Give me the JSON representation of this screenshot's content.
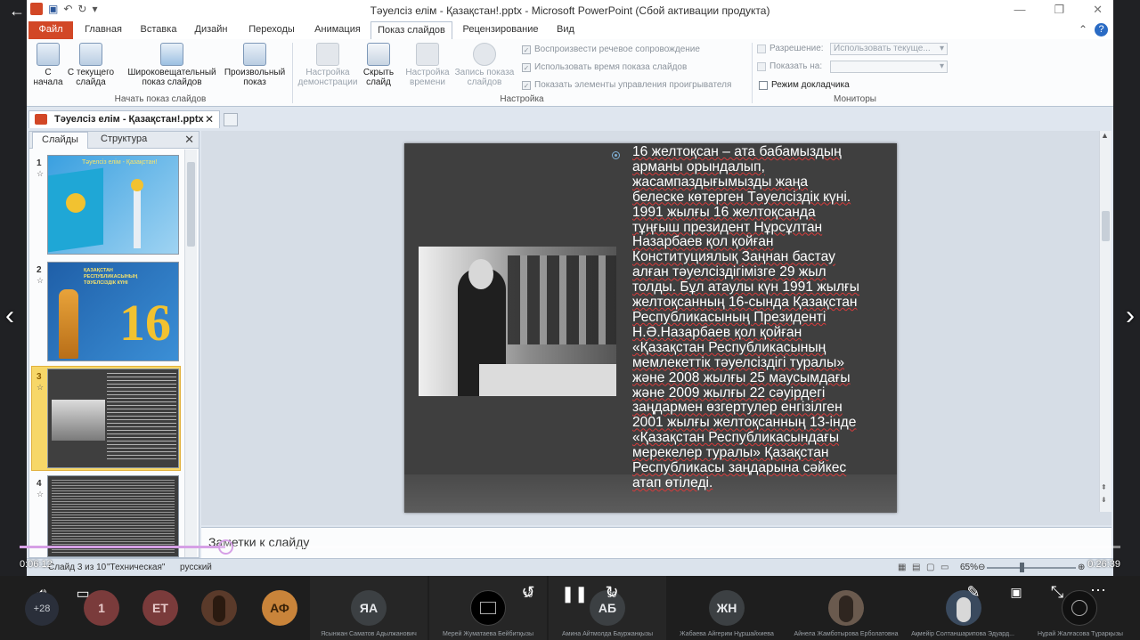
{
  "window": {
    "title": "Тәуелсіз елім - Қазақстан!.pptx  -  Microsoft PowerPoint (Сбой активации продукта)"
  },
  "ribbon_tabs": [
    {
      "label": "Файл"
    },
    {
      "label": "Главная"
    },
    {
      "label": "Вставка"
    },
    {
      "label": "Дизайн"
    },
    {
      "label": "Переходы"
    },
    {
      "label": "Анимация"
    },
    {
      "label": "Показ слайдов"
    },
    {
      "label": "Рецензирование"
    },
    {
      "label": "Вид"
    }
  ],
  "ribbon": {
    "start_group": {
      "label": "Начать показ слайдов",
      "buttons": [
        {
          "label": "С начала"
        },
        {
          "label": "С текущего слайда"
        },
        {
          "label": "Широковещательный показ слайдов"
        },
        {
          "label": "Произвольный показ"
        }
      ]
    },
    "setup_group": {
      "label": "Настройка",
      "buttons": [
        {
          "label": "Настройка демонстрации"
        },
        {
          "label": "Скрыть слайд"
        },
        {
          "label": "Настройка времени"
        },
        {
          "label": "Запись показа слайдов"
        }
      ],
      "checks": [
        {
          "label": "Воспроизвести речевое сопровождение"
        },
        {
          "label": "Использовать время показа слайдов"
        },
        {
          "label": "Показать элементы управления проигрывателя"
        }
      ]
    },
    "monitors_group": {
      "label": "Мониторы",
      "resolution_label": "Разрешение:",
      "resolution_value": "Использовать текуще...",
      "show_on_label": "Показать на:",
      "presenter_label": "Режим докладчика"
    }
  },
  "document_tab": {
    "label": "Тәуелсіз елім - Қазақстан!.pptx"
  },
  "slides_pane": {
    "tabs": [
      {
        "label": "Слайды"
      },
      {
        "label": "Структура"
      }
    ],
    "slides": [
      {
        "number": "1",
        "title": "Тәуелсіз елім - Қазақстан!"
      },
      {
        "number": "2",
        "title": "ҚАЗАҚСТАН РЕСПУБЛИКАСЫНЫҢ ТӘУЕЛСІЗДІК КҮНІ",
        "big": "16"
      },
      {
        "number": "3"
      },
      {
        "number": "4"
      }
    ]
  },
  "slide": {
    "lines": [
      "16 желтоқсан – ата бабамыздың",
      "арманы орындалып,",
      "жасампаздығымызды жаңа",
      "белеске көтерген Тәуелсіздік күні.",
      "1991 жылғы 16 желтоқсанда",
      "тұңғыш  президент  Нұрсұлтан",
      "Назарбаев  қол  қойған",
      "Конституциялық  Заңнан  бастау",
      "алған тәуелсіздігімізге  29  жыл",
      "толды. Бұл атаулы күн 1991 жылғы",
      "желтоқсанның  16-сында  Қазақстан",
      "Республикасының  Президенті",
      "Н.Ә.Назарбаев  қол  қойған",
      "«Қазақстан Республикасының",
      "мемлекеттік тәуелсіздігі туралы»",
      "және 2008 жылғы 25 маусымдағы",
      "және 2009 жылғы 22 сәуірдегі",
      "заңдармен өзгертулер енгізілген",
      "2001 жылғы желтоқсанның  13-інде",
      "«Қазақстан Республикасындағы",
      "мерекелер туралы» Қазақстан",
      "Республикасы  заңдарына  сәйкес",
      "атап өтіледі."
    ]
  },
  "notes": {
    "placeholder": "Заметки к слайду"
  },
  "status": {
    "slide_info": "Слайд 3 из 10",
    "theme": "\"Техническая\"",
    "language": "русский",
    "zoom": "65%"
  },
  "video": {
    "current_time": "0:06:12",
    "duration": "0:26:39",
    "progress": 0.187,
    "skip_back": "10",
    "skip_forward": "30",
    "participant_count": "+28"
  },
  "participants": [
    {
      "initials": "1",
      "color": "#7a3b3b"
    },
    {
      "initials": "ЕТ",
      "color": "#7a3b3b"
    },
    {
      "initials": "",
      "color": "#5a3a2a"
    },
    {
      "initials": "АФ",
      "color": "#c9843a"
    },
    {
      "initials": "ЯА",
      "name": "Ясынжан Саматов Адылжанович",
      "color": "#3c4043"
    },
    {
      "initials": "",
      "name": "Мерей Жуматаева Бейбитқызы",
      "color": "#000000"
    },
    {
      "initials": "АБ",
      "name": "Амина Айтмолда Бауржанқызы",
      "color": "#3c4043"
    },
    {
      "initials": "ЖН",
      "name": "Жабаева Айгерим Нұршайхиева",
      "color": "#3c4043"
    },
    {
      "initials": "",
      "name": "Айнела Жамботырова Ерболатовна",
      "color": "#6a5a4e"
    },
    {
      "initials": "",
      "name": "Ақмейір Солтаншарипова Эдуард...",
      "color": "#3a4a5e"
    },
    {
      "initials": "",
      "name": "Нұрай Жалғасова Тұрарқызы",
      "color": "#111111"
    }
  ],
  "colors": {
    "file_tab": "#d24726",
    "progress": "#d6a0e6",
    "slide_bg": "#3f3f3f"
  }
}
